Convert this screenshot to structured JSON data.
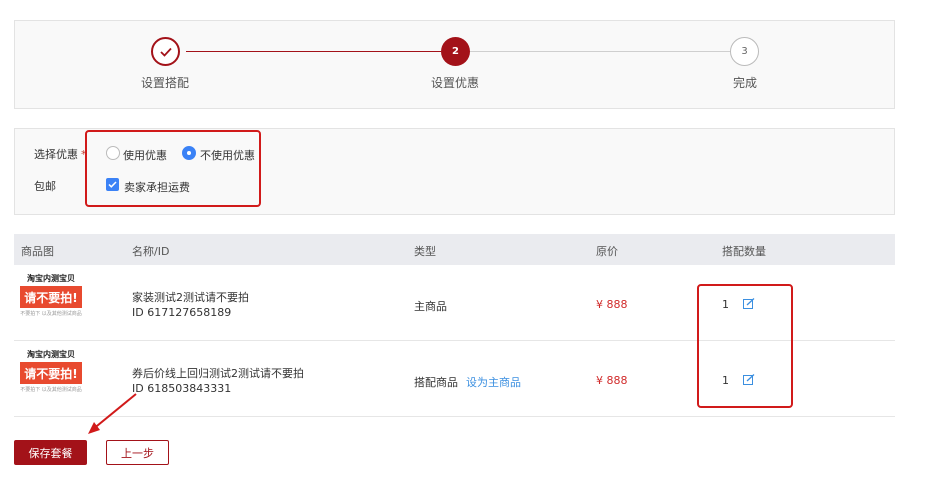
{
  "steps": [
    {
      "number": "✓",
      "label": "设置搭配",
      "state": "done"
    },
    {
      "number": "2",
      "label": "设置优惠",
      "state": "active"
    },
    {
      "number": "3",
      "label": "完成",
      "state": "todo"
    }
  ],
  "options": {
    "discount_label": "选择优惠",
    "required_mark": "*",
    "use_discount": "使用优惠",
    "no_discount": "不使用优惠",
    "selected": "不使用优惠",
    "shipping_label": "包邮",
    "seller_shipping": "卖家承担运费",
    "seller_shipping_checked": true
  },
  "table": {
    "headers": [
      "商品图",
      "名称/ID",
      "类型",
      "原价",
      "搭配数量"
    ],
    "thumb": {
      "title": "淘宝内测宝贝",
      "banner": "请不要拍!",
      "note": "不要拍下 以及其他测试商品"
    },
    "rows": [
      {
        "name": "家装测试2测试请不要拍",
        "id": "ID 617127658189",
        "type": "主商品",
        "action": "",
        "price": "¥ 888",
        "qty": "1"
      },
      {
        "name": "券后价线上回归测试2测试请不要拍",
        "id": "ID 618503843331",
        "type": "搭配商品",
        "action": "设为主商品",
        "price": "¥ 888",
        "qty": "1"
      }
    ]
  },
  "buttons": {
    "save": "保存套餐",
    "prev": "上一步"
  },
  "colors": {
    "brand": "#a31219",
    "accent_blue": "#3b82f6",
    "price_red": "#d12b2b",
    "annotation_red": "#d11a1a"
  }
}
